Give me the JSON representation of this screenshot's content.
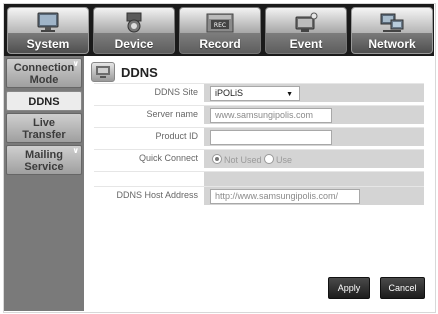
{
  "tabs": [
    {
      "label": "System",
      "icon": "monitor-icon",
      "active": true
    },
    {
      "label": "Device",
      "icon": "camera-icon",
      "active": false
    },
    {
      "label": "Record",
      "icon": "rec-icon",
      "active": false
    },
    {
      "label": "Event",
      "icon": "event-monitor-icon",
      "active": false
    },
    {
      "label": "Network",
      "icon": "network-icon",
      "active": true
    }
  ],
  "sidebar": {
    "items": [
      {
        "label": "Connection\nMode"
      },
      {
        "label": "DDNS"
      },
      {
        "label": "Live\nTransfer"
      },
      {
        "label": "Mailing\nService"
      }
    ]
  },
  "page": {
    "title": "DDNS",
    "fields": {
      "ddns_site": {
        "label": "DDNS Site",
        "value": "iPOLiS"
      },
      "server_name": {
        "label": "Server name",
        "value": "www.samsungipolis.com"
      },
      "product_id": {
        "label": "Product ID",
        "value": ""
      },
      "quick_connect": {
        "label": "Quick Connect",
        "options": [
          "Not Used",
          "Use"
        ],
        "selected": "Not Used"
      },
      "host_address": {
        "label": "DDNS Host Address",
        "value": "http://www.samsungipolis.com/"
      }
    },
    "buttons": {
      "apply": "Apply",
      "cancel": "Cancel"
    }
  },
  "colors": {
    "topbar_bg": "#1a1a1a",
    "sidebar_bg": "#7a7a7a",
    "value_row_bg": "#d4d4d4",
    "button_bg": "#2a2a2a"
  }
}
